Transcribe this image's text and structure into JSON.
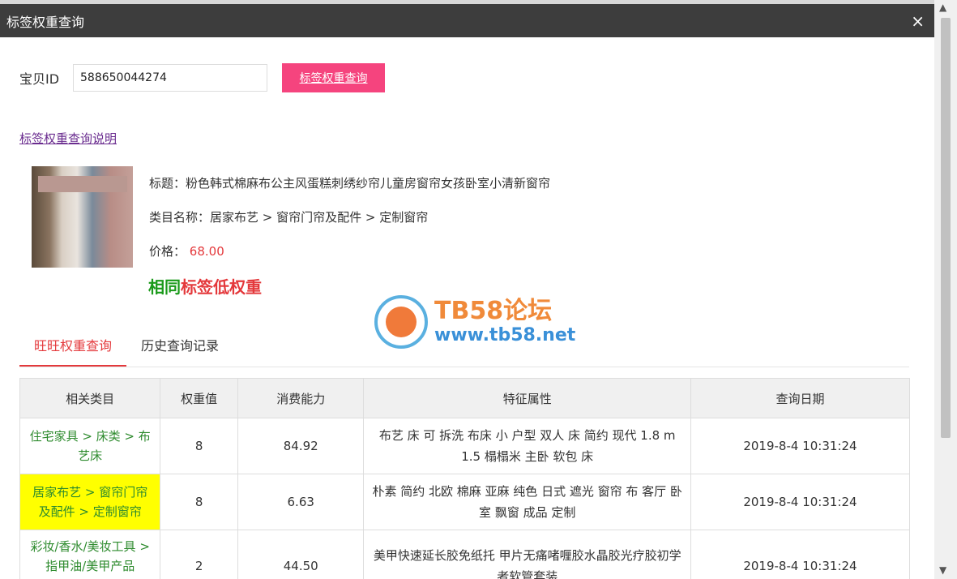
{
  "dialog": {
    "title": "标签权重查询",
    "close": "×"
  },
  "search": {
    "label": "宝贝ID",
    "value": "588650044274",
    "button": "标签权重查询"
  },
  "help_link": "标签权重查询说明",
  "product": {
    "title": "标题：粉色韩式棉麻布公主风蛋糕刺绣纱帘儿童房窗帘女孩卧室小清新窗帘",
    "category": "类目名称：居家布艺 > 窗帘门帘及配件 > 定制窗帘",
    "price_label": "价格：",
    "price": "68.00"
  },
  "verdict": {
    "green": "相同",
    "red": "标签低权重"
  },
  "watermark": {
    "line1": "TB58论坛",
    "line2": "www.tb58.net"
  },
  "tabs": [
    {
      "label": "旺旺权重查询"
    },
    {
      "label": "历史查询记录"
    }
  ],
  "table": {
    "headers": [
      "相关类目",
      "权重值",
      "消费能力",
      "特征属性",
      "查询日期"
    ],
    "rows": [
      {
        "category": "住宅家具 > 床类 > 布艺床",
        "weight": "8",
        "consumption": "84.92",
        "features": "布艺 床 可 拆洗 布床 小 户型 双人 床 简约 现代 1.8 m 1.5 榻榻米 主卧 软包 床",
        "date": "2019-8-4 10:31:24"
      },
      {
        "category": "居家布艺 > 窗帘门帘及配件 > 定制窗帘",
        "weight": "8",
        "consumption": "6.63",
        "features": "朴素 简约 北欧 棉麻 亚麻 纯色 日式 遮光 窗帘 布 客厅 卧室 飘窗 成品 定制",
        "date": "2019-8-4 10:31:24"
      },
      {
        "category": "彩妆/香水/美妆工具 > 指甲油/美甲产品（新） > 指甲",
        "weight": "2",
        "consumption": "44.50",
        "features": "美甲快速延长胶免纸托 甲片无痛啫喱胶水晶胶光疗胶初学者软管套装",
        "date": "2019-8-4 10:31:24"
      }
    ]
  }
}
